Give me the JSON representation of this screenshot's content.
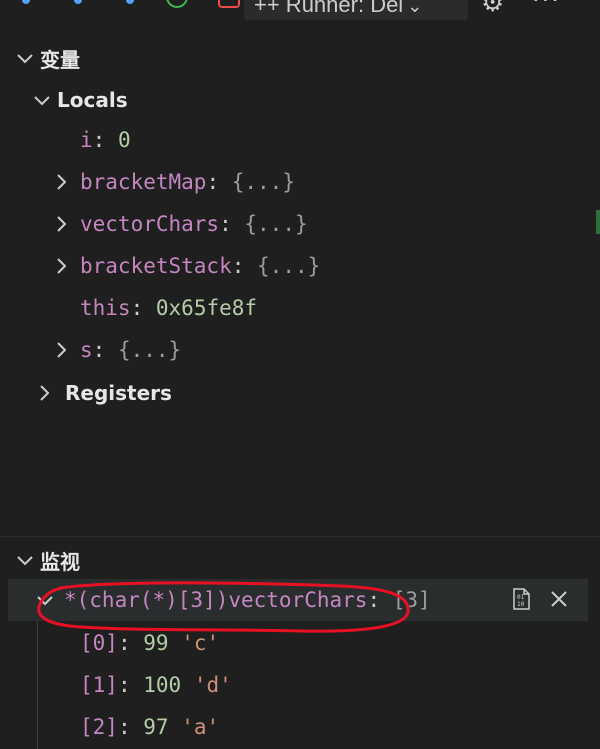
{
  "toolbar": {
    "config_label": "++ Runner: Del",
    "icons": [
      "debug-dot-icon",
      "restart-icon",
      "stop-icon",
      "gear-icon",
      "more-icon"
    ]
  },
  "variables": {
    "title": "变量",
    "locals": {
      "label": "Locals",
      "items": [
        {
          "name": "i",
          "sep": ":",
          "value": "0",
          "kind": "number",
          "expandable": false
        },
        {
          "name": "bracketMap",
          "sep": ":",
          "value": "{...}",
          "kind": "object",
          "expandable": true
        },
        {
          "name": "vectorChars",
          "sep": ":",
          "value": "{...}",
          "kind": "object",
          "expandable": true
        },
        {
          "name": "bracketStack",
          "sep": ":",
          "value": "{...}",
          "kind": "object",
          "expandable": true
        },
        {
          "name": "this",
          "sep": ":",
          "value": "0x65fe8f",
          "kind": "number",
          "expandable": false
        },
        {
          "name": "s",
          "sep": ":",
          "value": "{...}",
          "kind": "object",
          "expandable": true
        }
      ]
    },
    "registers": {
      "label": "Registers"
    }
  },
  "watch": {
    "title": "监视",
    "expression": {
      "text": "*(char(*)[3])vectorChars",
      "sep": ":",
      "value": "[3]",
      "children": [
        {
          "index": "[0]",
          "sep": ":",
          "num": "99",
          "char": "'c'"
        },
        {
          "index": "[1]",
          "sep": ":",
          "num": "100",
          "char": "'d'"
        },
        {
          "index": "[2]",
          "sep": ":",
          "num": "97",
          "char": "'a'"
        }
      ]
    }
  },
  "colors": {
    "background": "#1f1f1f",
    "var_name": "#c586c0",
    "number": "#b5cea8",
    "string": "#ce9178",
    "annotation": "#e81123"
  }
}
